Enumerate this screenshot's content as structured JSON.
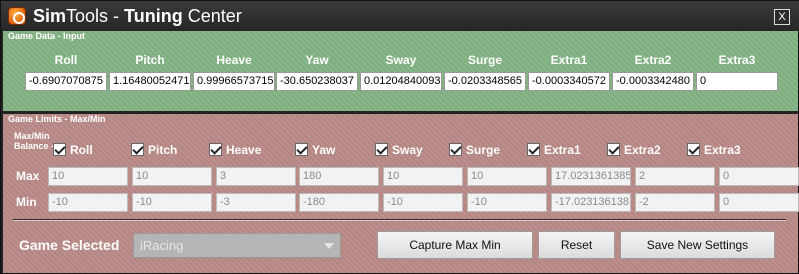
{
  "window": {
    "title_bold": "Sim",
    "title_mid": "Tools - ",
    "title_bold2": "Tuning",
    "title_end": " Center",
    "close_label": "X"
  },
  "input_section": {
    "title": "Game Data - Input",
    "columns": [
      "Roll",
      "Pitch",
      "Heave",
      "Yaw",
      "Sway",
      "Surge",
      "Extra1",
      "Extra2",
      "Extra3"
    ],
    "values": [
      "-0.6907070875",
      "1.16480052471",
      "0.99966573715",
      "-30.650238037",
      "0.01204840093",
      "-0.0203348565",
      "-0.0003340572",
      "-0.0003342480",
      "0"
    ]
  },
  "limits_section": {
    "title": "Game Limits - Max/Min",
    "balance_label_1": "Max/Min",
    "balance_label_2": "Balance -",
    "checkboxes": [
      "Roll",
      "Pitch",
      "Heave",
      "Yaw",
      "Sway",
      "Surge",
      "Extra1",
      "Extra2",
      "Extra3"
    ],
    "max_label": "Max",
    "min_label": "Min",
    "max_values": [
      "10",
      "10",
      "3",
      "180",
      "10",
      "10",
      "17.0231361385",
      "2",
      "0"
    ],
    "min_values": [
      "-10",
      "-10",
      "-3",
      "-180",
      "-10",
      "-10",
      "-17.023136138",
      "-2",
      "0"
    ]
  },
  "footer": {
    "game_label": "Game Selected",
    "game_value": "iRacing",
    "capture_button": "Capture Max Min",
    "reset_button": "Reset",
    "save_button": "Save New Settings"
  }
}
